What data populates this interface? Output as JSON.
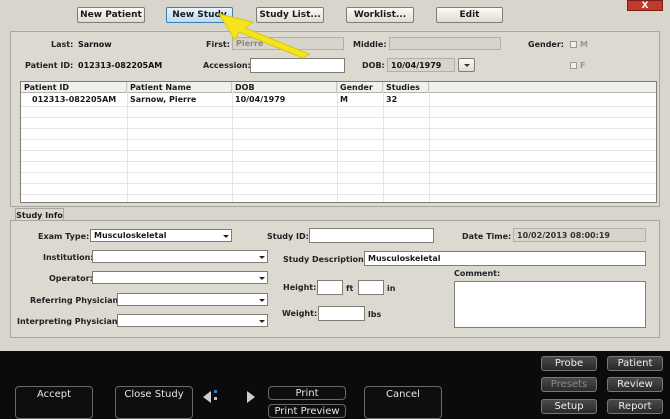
{
  "toolbar": {
    "new_patient": "New Patient",
    "new_study": "New Study",
    "study_list": "Study List...",
    "worklist": "Worklist...",
    "edit": "Edit"
  },
  "patient": {
    "last_label": "Last:",
    "last_value": "Sarnow",
    "first_label": "First:",
    "first_value": "Pierre",
    "middle_label": "Middle:",
    "middle_value": "",
    "gender_label": "Gender:",
    "gender_m": "M",
    "gender_f": "F",
    "patient_id_label": "Patient ID:",
    "patient_id_value": "012313-082205AM",
    "accession_label": "Accession:",
    "accession_value": "",
    "dob_label": "DOB:",
    "dob_value": "10/04/1979"
  },
  "grid": {
    "columns": [
      "Patient ID",
      "Patient Name",
      "DOB",
      "Gender",
      "Studies"
    ],
    "rows": [
      [
        "012313-082205AM",
        "Sarnow, Pierre",
        "10/04/1979",
        "M",
        "32"
      ]
    ]
  },
  "study_info": {
    "tab_label": "Study Info",
    "exam_type_label": "Exam Type:",
    "exam_type_value": "Musculoskeletal",
    "institution_label": "Institution:",
    "institution_value": "",
    "operator_label": "Operator:",
    "operator_value": "",
    "referring_label": "Referring Physician:",
    "referring_value": "",
    "interpreting_label": "Interpreting Physician:",
    "interpreting_value": "",
    "study_id_label": "Study ID:",
    "study_id_value": "",
    "study_desc_label": "Study Description:",
    "study_desc_value": "Musculoskeletal",
    "height_label": "Height:",
    "height_unit_ft": "ft",
    "height_unit_in": "in",
    "weight_label": "Weight:",
    "weight_unit": "lbs",
    "datetime_label": "Date Time:",
    "datetime_value": "10/02/2013 08:00:19",
    "comment_label": "Comment:"
  },
  "bottom": {
    "accept": "Accept",
    "close_study": "Close Study",
    "print": "Print",
    "print_preview": "Print Preview",
    "cancel": "Cancel",
    "probe": "Probe",
    "patient": "Patient",
    "presets": "Presets",
    "review": "Review",
    "setup": "Setup",
    "report": "Report"
  },
  "window": {
    "close_glyph": "X"
  },
  "colors": {
    "annotation_arrow": "#f5e41c",
    "accent_blue": "#3c7fb1"
  }
}
